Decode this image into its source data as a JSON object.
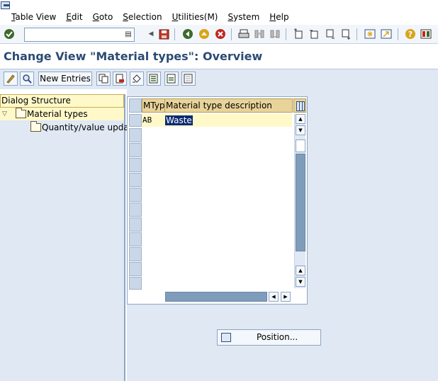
{
  "menu": {
    "items": [
      {
        "ul": "T",
        "rest": "able View"
      },
      {
        "ul": "E",
        "rest": "dit"
      },
      {
        "ul": "G",
        "rest": "oto"
      },
      {
        "ul": "S",
        "rest": "election"
      },
      {
        "ul": "U",
        "rest": "tilities(M)"
      },
      {
        "ul": "S",
        "rest": "ystem"
      },
      {
        "ul": "H",
        "rest": "elp"
      }
    ]
  },
  "command_field": {
    "value": ""
  },
  "title": "Change View \"Material types\": Overview",
  "app_toolbar": {
    "new_entries": "New Entries"
  },
  "dialog_structure": {
    "header": "Dialog Structure",
    "items": [
      {
        "label": "Material types",
        "selected": true
      },
      {
        "label": "Quantity/value updat",
        "selected": false
      }
    ]
  },
  "table": {
    "columns": [
      "MTyp",
      "Material type description"
    ],
    "rows": [
      {
        "code": "AB",
        "description": "Waste"
      }
    ]
  },
  "position_button": "Position...",
  "colors": {
    "title": "#2c4b73",
    "toolbar_bg": "#dfe8f3",
    "header_bg": "#e8d39a",
    "selected_row_bg": "#fff9c9",
    "selection_highlight": "#0b2a73"
  },
  "icons": {
    "std_toolbar": [
      "enter-icon",
      "save-icon",
      "back-icon",
      "exit-icon",
      "cancel-icon",
      "print-icon",
      "find-icon",
      "find-next-icon",
      "first-page-icon",
      "previous-page-icon",
      "next-page-icon",
      "last-page-icon",
      "create-session-icon",
      "shortcut-icon",
      "help-icon",
      "customize-layout-icon"
    ]
  }
}
